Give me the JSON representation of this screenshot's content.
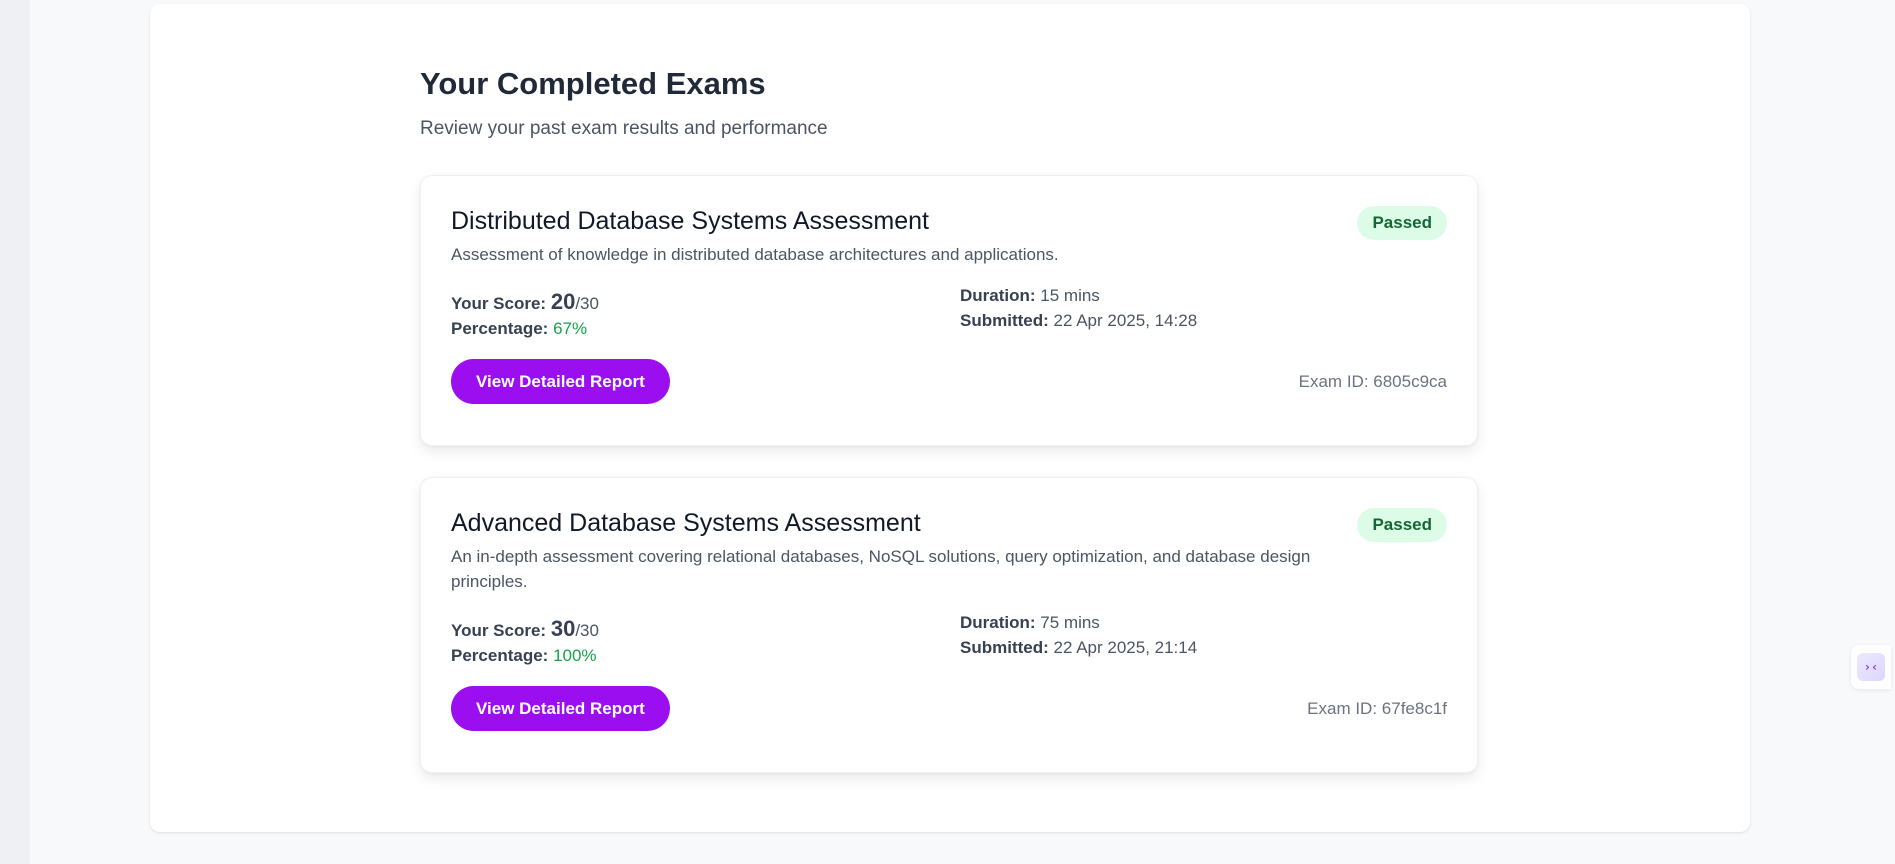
{
  "header": {
    "title": "Your Completed Exams",
    "subtitle": "Review your past exam results and performance"
  },
  "exams": [
    {
      "title": "Distributed Database Systems Assessment",
      "description": "Assessment of knowledge in distributed database architectures and applications.",
      "status": "Passed",
      "score_label": "Your Score:",
      "score": "20",
      "score_total": "/30",
      "percentage_label": "Percentage:",
      "percentage": "67%",
      "duration_label": "Duration:",
      "duration": "15 mins",
      "submitted_label": "Submitted:",
      "submitted": "22 Apr 2025, 14:28",
      "button_label": "View Detailed Report",
      "exam_id": "Exam ID: 6805c9ca"
    },
    {
      "title": "Advanced Database Systems Assessment",
      "description": "An in-depth assessment covering relational databases, NoSQL solutions, query optimization, and database design principles.",
      "status": "Passed",
      "score_label": "Your Score:",
      "score": "30",
      "score_total": "/30",
      "percentage_label": "Percentage:",
      "percentage": "100%",
      "duration_label": "Duration:",
      "duration": "75 mins",
      "submitted_label": "Submitted:",
      "submitted": "22 Apr 2025, 21:14",
      "button_label": "View Detailed Report",
      "exam_id": "Exam ID: 67fe8c1f"
    }
  ],
  "side_toggle": {
    "icon": "collapse-arrows-icon",
    "glyph": "›‹"
  },
  "colors": {
    "accent": "#9b0ef0",
    "passed_bg": "#dcfce7",
    "passed_text": "#166534",
    "percentage": "#16a34a"
  }
}
